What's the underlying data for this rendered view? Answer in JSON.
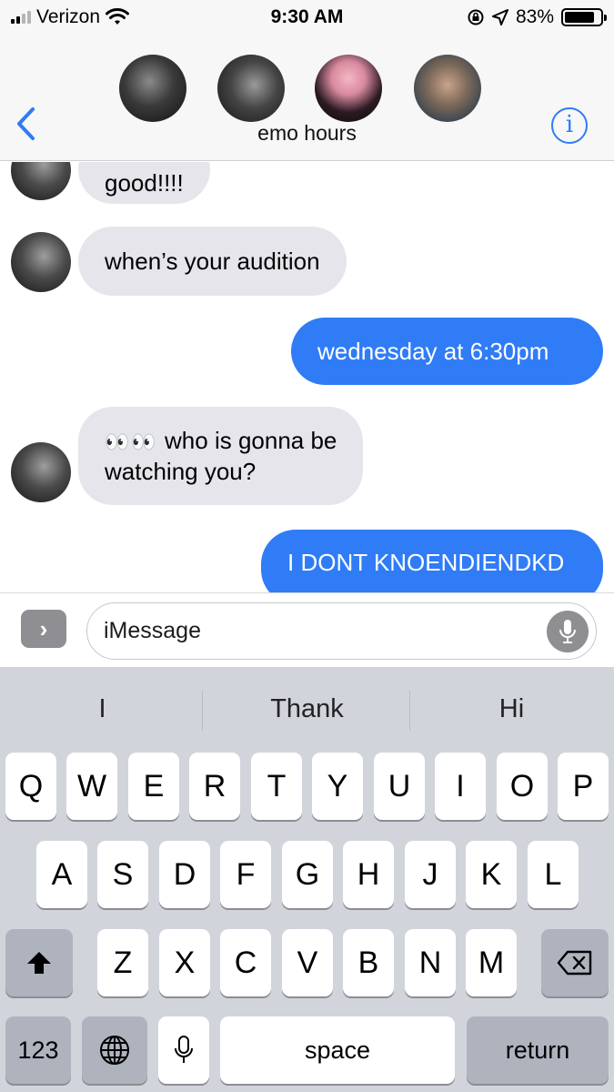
{
  "status_bar": {
    "carrier": "Verizon",
    "time": "9:30 AM",
    "battery": "83%",
    "battery_level": 0.83
  },
  "header": {
    "back_icon": "chevron-left-icon",
    "info_glyph": "i",
    "group_name": "emo hours",
    "avatars": [
      "participant-1",
      "participant-2",
      "participant-3",
      "participant-4"
    ]
  },
  "messages": [
    {
      "direction": "incoming",
      "text": "good!!!!"
    },
    {
      "direction": "incoming",
      "text": "when’s your audition"
    },
    {
      "direction": "outgoing",
      "text": "wednesday at 6:30pm"
    },
    {
      "direction": "incoming",
      "emoji": "👀👀",
      "line1": "who is gonna be",
      "line2": "watching you?"
    },
    {
      "direction": "outgoing",
      "text": "I DONT KNOENDIENDKD"
    }
  ],
  "input_bar": {
    "apps_glyph": "›",
    "placeholder": "iMessage"
  },
  "keyboard": {
    "suggestions": [
      "I",
      "Thank",
      "Hi"
    ],
    "row1": [
      "Q",
      "W",
      "E",
      "R",
      "T",
      "Y",
      "U",
      "I",
      "O",
      "P"
    ],
    "row2": [
      "A",
      "S",
      "D",
      "F",
      "G",
      "H",
      "J",
      "K",
      "L"
    ],
    "row3": [
      "Z",
      "X",
      "C",
      "V",
      "B",
      "N",
      "M"
    ],
    "numbers_label": "123",
    "space_label": "space",
    "return_label": "return"
  },
  "colors": {
    "accent": "#2f7cf6",
    "incoming_bubble": "#e6e5eb",
    "keyboard_bg": "#d1d4da"
  }
}
